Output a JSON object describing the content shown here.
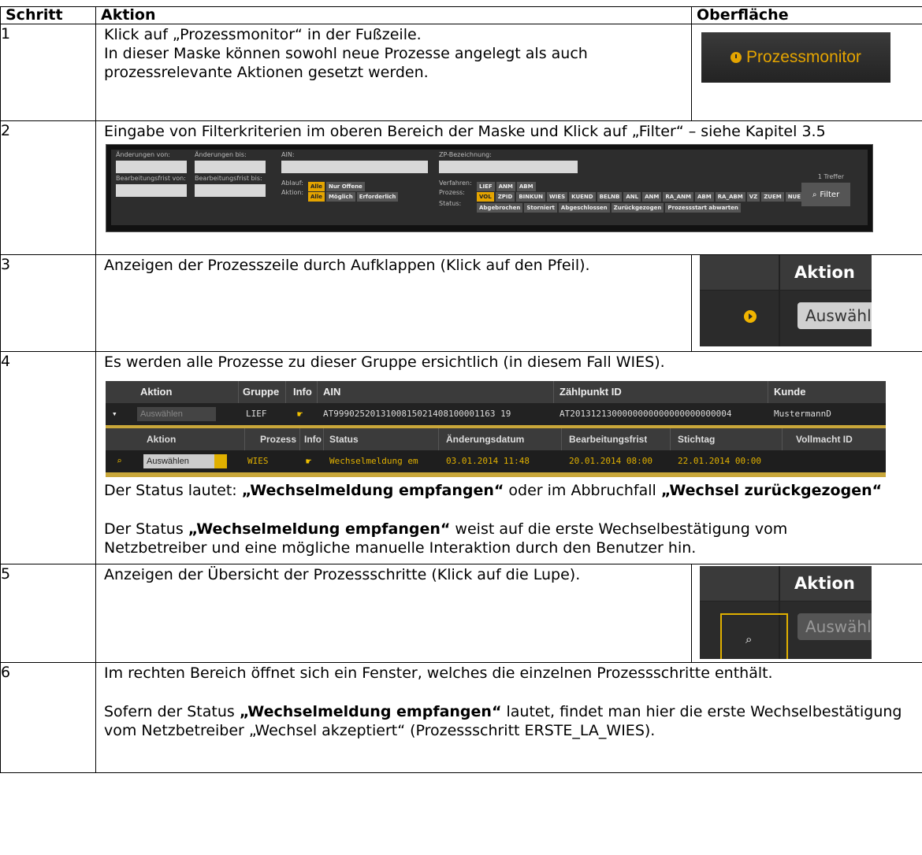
{
  "table": {
    "headers": [
      "Schritt",
      "Aktion",
      "Oberfläche"
    ],
    "rows": [
      {
        "num": "1",
        "text_1": "Klick auf „Prozessmonitor“ in der Fußzeile.",
        "text_2": "In dieser Maske können sowohl neue Prozesse angelegt als auch prozessrelevante Aktionen gesetzt werden.",
        "ui_label": "Prozessmonitor"
      },
      {
        "num": "2",
        "text": "Eingabe von Filterkriterien im oberen Bereich der Maske und Klick auf „Filter“ – siehe Kapitel 3.5"
      },
      {
        "num": "3",
        "text": "Anzeigen der Prozesszeile durch Aufklappen (Klick auf den Pfeil).",
        "ui_header": "Aktion",
        "ui_select": "Auswähle"
      },
      {
        "num": "4",
        "text": "Es werden alle Prozesse zu dieser Gruppe ersichtlich (in diesem Fall WIES).",
        "status_prefix": "Der Status lautet: ",
        "status_bold_1": "„Wechselmeldung empfangen“",
        "status_mid": " oder im Abbruchfall ",
        "status_bold_2": "„Wechsel zurückgezogen“",
        "para2_prefix": "Der Status ",
        "para2_bold": "„Wechselmeldung empfangen“",
        "para2_rest": " weist auf die erste Wechselbestätigung vom Netzbetreiber und eine mögliche manuelle Interaktion durch den Benutzer hin."
      },
      {
        "num": "5",
        "text": "Anzeigen der Übersicht der Prozessschritte (Klick auf die Lupe).",
        "ui_header": "Aktion",
        "ui_select": "Auswähle"
      },
      {
        "num": "6",
        "text": "Im rechten Bereich öffnet sich ein Fenster, welches die einzelnen Prozessschritte enthält.",
        "p2_prefix": "Sofern der Status ",
        "p2_bold": "„Wechselmeldung empfangen“",
        "p2_rest": " lautet, findet man hier die erste Wechselbestätigung vom Netzbetreiber „Wechsel akzeptiert“ (Prozessschritt ERSTE_LA_WIES)."
      }
    ]
  },
  "filter_panel": {
    "labels": {
      "changes_from": "Änderungen von:",
      "changes_to": "Änderungen bis:",
      "ain": "AIN:",
      "zp": "ZP-Bezeichnung:",
      "deadline_from": "Bearbeitungsfrist von:",
      "deadline_to": "Bearbeitungsfrist bis:",
      "ablauf": "Ablauf:",
      "aktion": "Aktion:",
      "verfahren": "Verfahren:",
      "prozess": "Prozess:",
      "status": "Status:",
      "hits": "1 Treffer",
      "filter_btn": "Filter"
    },
    "ablauf_chips": [
      "Alle",
      "Nur Offene"
    ],
    "aktion_chips": [
      "Alle",
      "Möglich",
      "Erforderlich"
    ],
    "verfahren_chips": [
      "LIEF",
      "ANM",
      "ABM"
    ],
    "prozess_chips": [
      "VOL",
      "ZPID",
      "BINKUN",
      "WIES",
      "KUEND",
      "BELNB",
      "ANL",
      "ANM",
      "RA_ANM",
      "ABM",
      "RA_ABM",
      "VZ",
      "ZUEM",
      "NUE"
    ],
    "status_chips": [
      "Abgebrochen",
      "Storniert",
      "Abgeschlossen",
      "Zurückgezogen",
      "Prozessstart abwarten"
    ]
  },
  "grid": {
    "header1": [
      "Aktion",
      "Gruppe",
      "Info",
      "AIN",
      "Zählpunkt ID",
      "Kunde"
    ],
    "row1": {
      "select": "Auswählen",
      "gruppe": "LIEF",
      "ain": "AT9990252013100815021408100001163 19",
      "zp": "AT2013121300000000000000000000004",
      "kunde": "MustermannD"
    },
    "header2": [
      "Aktion",
      "Prozess",
      "Info",
      "Status",
      "Änderungsdatum",
      "Bearbeitungsfrist",
      "Stichtag",
      "Vollmacht ID"
    ],
    "row2": {
      "select": "Auswählen",
      "prozess": "WIES",
      "status": "Wechselmeldung em",
      "aenderung": "03.01.2014 11:48",
      "frist": "20.01.2014 08:00",
      "stichtag": "22.01.2014 00:00"
    }
  }
}
